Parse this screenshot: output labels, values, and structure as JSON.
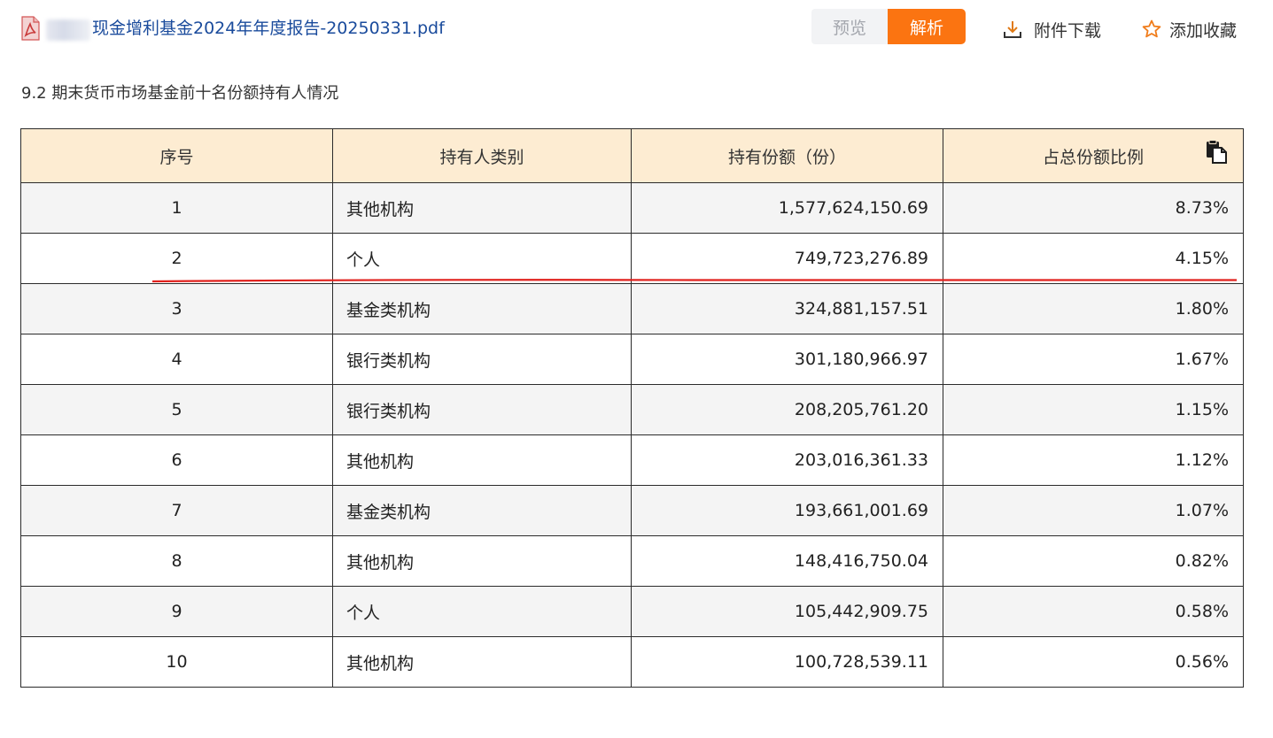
{
  "header": {
    "file_title": "现金增利基金2024年年度报告-20250331.pdf",
    "preview_label": "预览",
    "parse_label": "解析",
    "download_label": "附件下载",
    "favorite_label": "添加收藏"
  },
  "section": {
    "title": "9.2  期末货币市场基金前十名份额持有人情况"
  },
  "table": {
    "headers": [
      "序号",
      "持有人类别",
      "持有份额（份）",
      "占总份额比例"
    ],
    "rows": [
      {
        "idx": "1",
        "type": "其他机构",
        "shares": "1,577,624,150.69",
        "pct": "8.73%"
      },
      {
        "idx": "2",
        "type": "个人",
        "shares": "749,723,276.89",
        "pct": "4.15%"
      },
      {
        "idx": "3",
        "type": "基金类机构",
        "shares": "324,881,157.51",
        "pct": "1.80%"
      },
      {
        "idx": "4",
        "type": "银行类机构",
        "shares": "301,180,966.97",
        "pct": "1.67%"
      },
      {
        "idx": "5",
        "type": "银行类机构",
        "shares": "208,205,761.20",
        "pct": "1.15%"
      },
      {
        "idx": "6",
        "type": "其他机构",
        "shares": "203,016,361.33",
        "pct": "1.12%"
      },
      {
        "idx": "7",
        "type": "基金类机构",
        "shares": "193,661,001.69",
        "pct": "1.07%"
      },
      {
        "idx": "8",
        "type": "其他机构",
        "shares": "148,416,750.04",
        "pct": "0.82%"
      },
      {
        "idx": "9",
        "type": "个人",
        "shares": "105,442,909.75",
        "pct": "0.58%"
      },
      {
        "idx": "10",
        "type": "其他机构",
        "shares": "100,728,539.11",
        "pct": "0.56%"
      }
    ]
  },
  "colors": {
    "accent": "#fb7411",
    "link": "#1a4b9c",
    "header_bg": "#fdecd2",
    "annotation": "#e0201c"
  },
  "icons": {
    "file": "pdf-icon",
    "download": "download-icon",
    "favorite": "star-icon",
    "copy": "copy-icon"
  }
}
